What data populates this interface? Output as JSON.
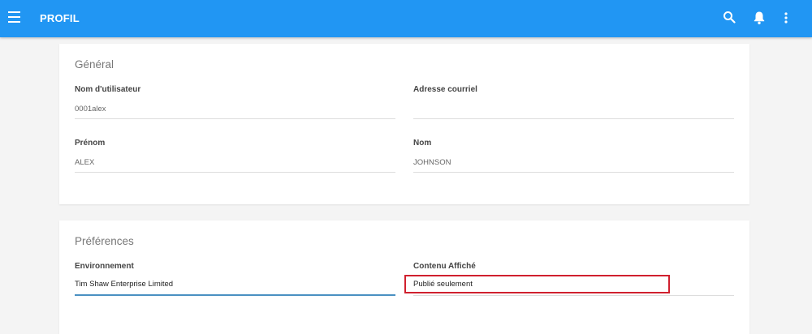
{
  "appbar": {
    "title": "PROFIL",
    "color": "#2196f3",
    "icons": [
      "menu-icon",
      "search-icon",
      "bell-icon",
      "more-vert-icon"
    ]
  },
  "general": {
    "title": "Général",
    "username": {
      "label": "Nom d'utilisateur",
      "value": "0001alex"
    },
    "email": {
      "label": "Adresse courriel",
      "value": ""
    },
    "firstname": {
      "label": "Prénom",
      "value": "ALEX"
    },
    "lastname": {
      "label": "Nom",
      "value": "JOHNSON"
    }
  },
  "preferences": {
    "title": "Préférences",
    "environment": {
      "label": "Environnement",
      "value": "Tim Shaw Enterprise Limited"
    },
    "content": {
      "label": "Contenu Affiché",
      "value": "Publié seulement"
    },
    "highlight_color": "#d0202e"
  }
}
